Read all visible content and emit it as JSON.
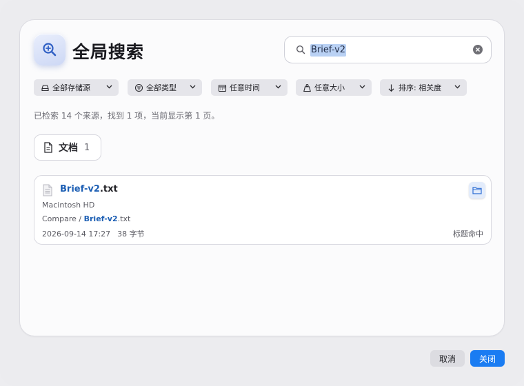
{
  "header": {
    "title": "全局搜索",
    "icon": "magnifier-plus-icon"
  },
  "search": {
    "value": "Brief-v2",
    "placeholder": ""
  },
  "filters": [
    {
      "label": "全部存储源",
      "icon": "drive-icon"
    },
    {
      "label": "全部类型",
      "icon": "filter-icon"
    },
    {
      "label": "任意时间",
      "icon": "calendar-icon"
    },
    {
      "label": "任意大小",
      "icon": "weight-icon"
    },
    {
      "label": "排序: 相关度",
      "icon": "arrow-down-icon"
    }
  ],
  "status_text": "已检索 14 个来源，找到 1 项，当前显示第 1 页。",
  "tabs": [
    {
      "label": "文档",
      "count": "1",
      "icon": "document-icon"
    }
  ],
  "results": [
    {
      "name_match": "Brief-v2",
      "name_rest": ".txt",
      "volume": "Macintosh HD",
      "path_prefix": "Compare / ",
      "path_match": "Brief-v2",
      "path_suffix": ".txt",
      "date": "2026-09-14 17:27",
      "size": "38 字节",
      "match_type": "标题命中"
    }
  ],
  "footer": {
    "cancel_label": "取消",
    "close_label": "关闭"
  },
  "colors": {
    "accent": "#1a7cf2",
    "highlight": "#1d5fb4",
    "selection": "#b9d1f4"
  }
}
